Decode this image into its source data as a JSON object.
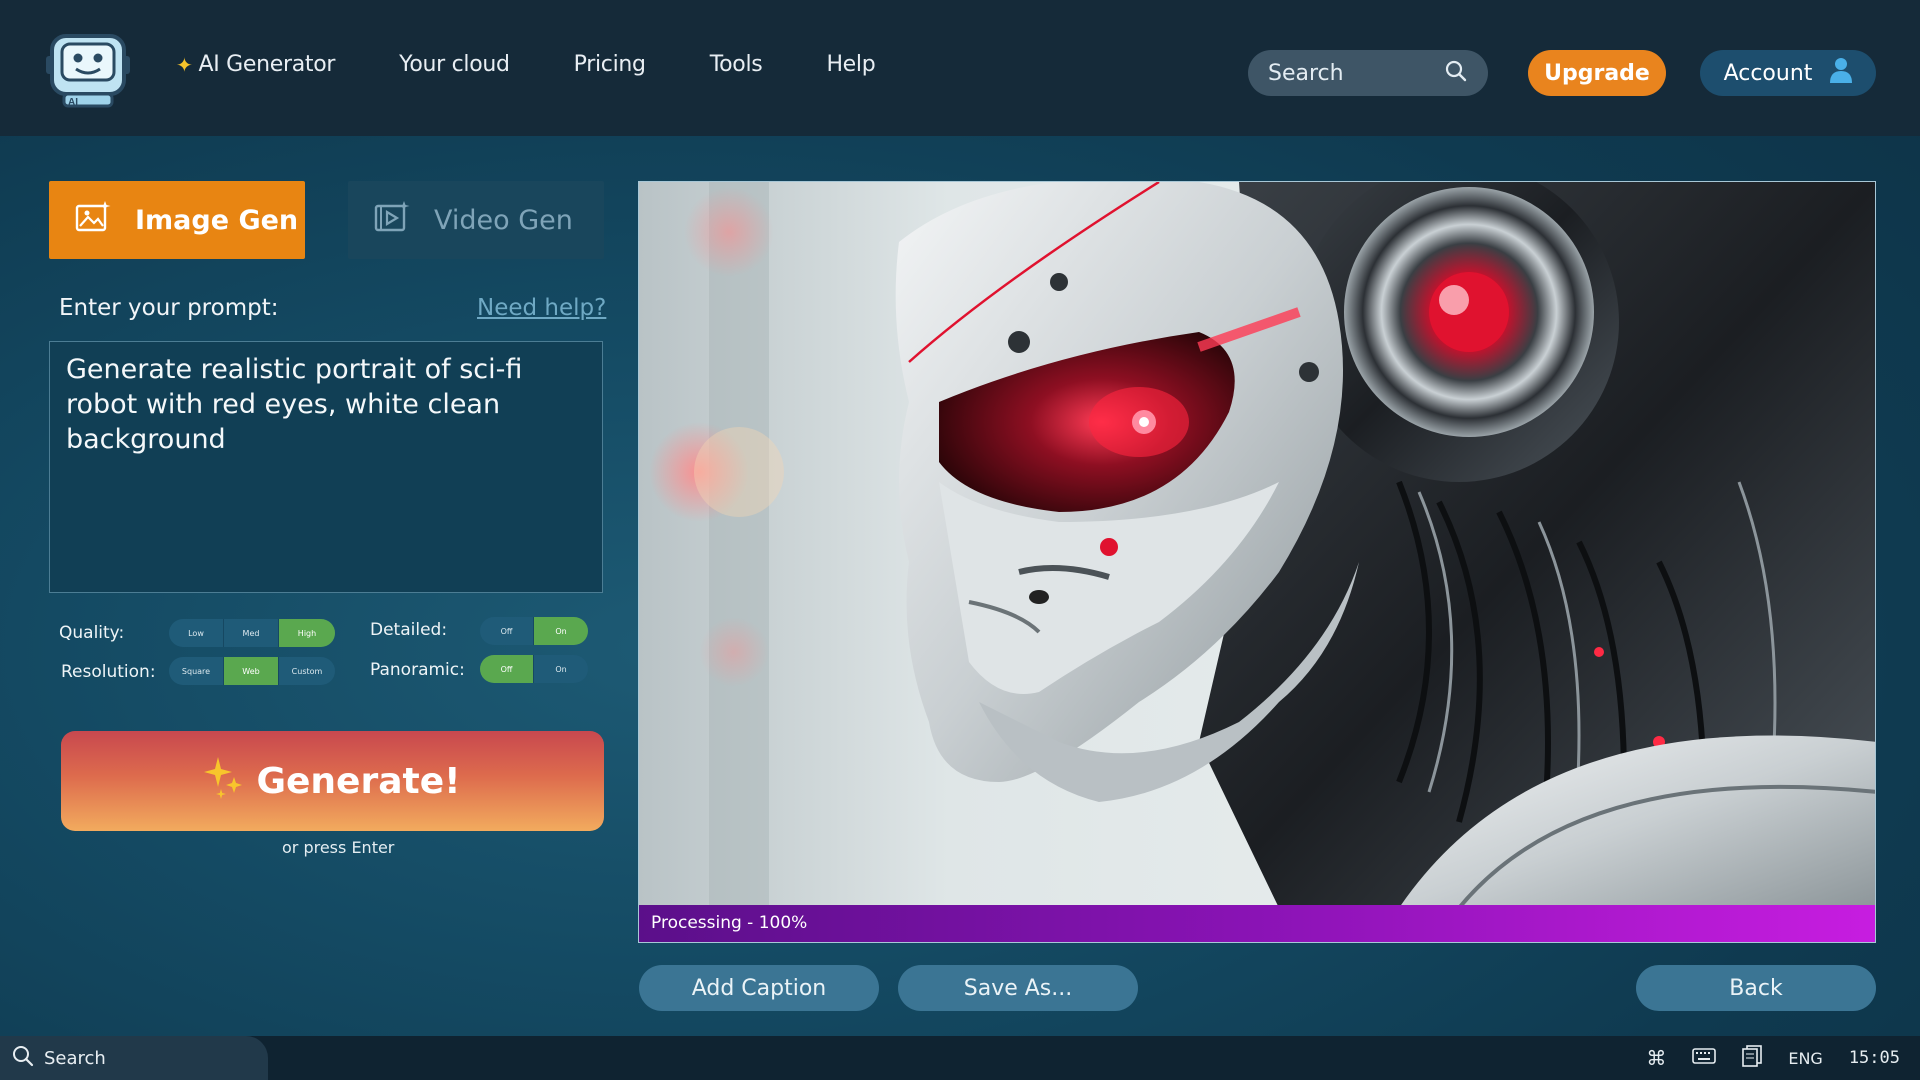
{
  "nav": {
    "items": [
      {
        "label": "AI Generator",
        "icon": "sparkle-icon"
      },
      {
        "label": "Your cloud"
      },
      {
        "label": "Pricing"
      },
      {
        "label": "Tools"
      },
      {
        "label": "Help"
      }
    ],
    "search_placeholder": "Search",
    "upgrade_label": "Upgrade",
    "account_label": "Account",
    "logo_text": "AI"
  },
  "tabs": {
    "image_gen": "Image Gen",
    "video_gen": "Video Gen"
  },
  "prompt": {
    "label": "Enter your prompt:",
    "help_link": "Need help?",
    "value": "Generate realistic portrait of sci-fi robot with red eyes, white clean background"
  },
  "options": {
    "quality": {
      "label": "Quality:",
      "choices": [
        "Low",
        "Med",
        "High"
      ],
      "selected": "High"
    },
    "resolution": {
      "label": "Resolution:",
      "choices": [
        "Square",
        "Web",
        "Custom"
      ],
      "selected": "Web"
    },
    "detailed": {
      "label": "Detailed:",
      "choices": [
        "Off",
        "On"
      ],
      "selected": "On"
    },
    "panoramic": {
      "label": "Panoramic:",
      "choices": [
        "Off",
        "On"
      ],
      "selected": "Off"
    }
  },
  "generate": {
    "label": "Generate!",
    "hint": "or press Enter"
  },
  "result": {
    "progress_text": "Processing - 100%",
    "progress_fraction": 1.0
  },
  "actions": {
    "add_caption": "Add Caption",
    "save_as": "Save As...",
    "back": "Back"
  },
  "taskbar": {
    "search_label": "Search",
    "language": "ENG",
    "time": "15:05"
  },
  "colors": {
    "accent_orange": "#e9841e",
    "selected_green": "#5aa84f",
    "progress_purple": "#c71de0",
    "robot_red": "#e0122f"
  }
}
